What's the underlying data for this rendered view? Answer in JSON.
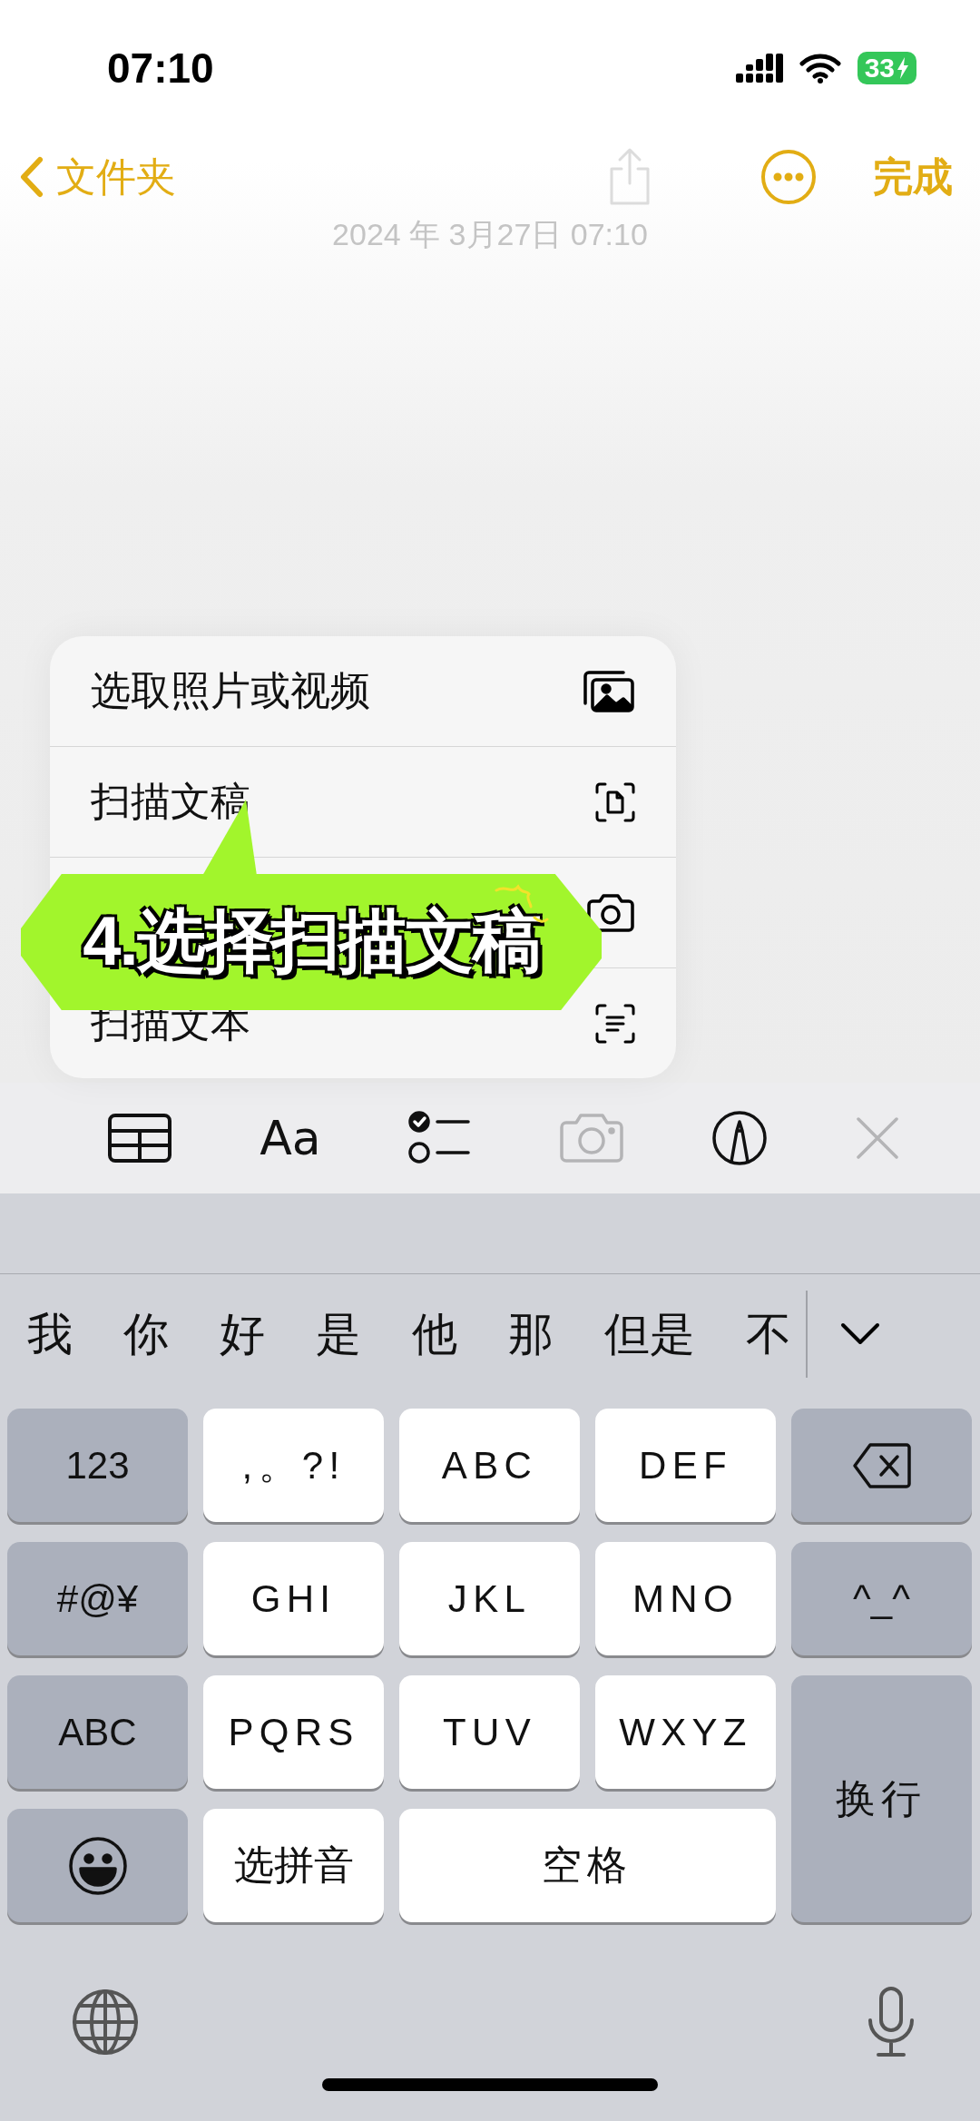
{
  "status_bar": {
    "time": "07:10",
    "battery": "33",
    "charging": true
  },
  "nav_bar": {
    "back_label": "文件夹",
    "done_label": "完成",
    "share_disabled": true
  },
  "note": {
    "date": "2024 年 3月27日 07:10"
  },
  "attach_menu": {
    "items": [
      {
        "kind": "photos",
        "label": "选取照片或视频"
      },
      {
        "kind": "scan-document",
        "label": "扫描文稿"
      },
      {
        "kind": "camera"
      },
      {
        "kind": "scan-text",
        "label": "扫描文本"
      }
    ]
  },
  "callout": {
    "text": "4.选择扫描文稿"
  },
  "format_toolbar": {
    "items": [
      {
        "kind": "table",
        "disabled": false
      },
      {
        "kind": "format",
        "label": "Aa",
        "disabled": false
      },
      {
        "kind": "checklist",
        "disabled": false
      },
      {
        "kind": "camera",
        "disabled": true
      },
      {
        "kind": "markup",
        "disabled": false
      },
      {
        "kind": "close",
        "disabled": true
      }
    ]
  },
  "candidates": {
    "words": [
      "我",
      "你",
      "好",
      "是",
      "他",
      "那",
      "但是",
      "不"
    ]
  },
  "keyboard": {
    "keys": [
      {
        "kind": "function",
        "label": "123"
      },
      {
        "kind": "letter",
        "label": ",。?!"
      },
      {
        "kind": "letter",
        "label": "ABC"
      },
      {
        "kind": "letter",
        "label": "DEF"
      },
      {
        "kind": "delete"
      },
      {
        "kind": "function",
        "label": "#@¥"
      },
      {
        "kind": "letter",
        "label": "GHI"
      },
      {
        "kind": "letter",
        "label": "JKL"
      },
      {
        "kind": "letter",
        "label": "MNO"
      },
      {
        "kind": "function",
        "label": "^_^"
      },
      {
        "kind": "function",
        "label": "ABC"
      },
      {
        "kind": "letter",
        "label": "PQRS"
      },
      {
        "kind": "letter",
        "label": "TUV"
      },
      {
        "kind": "letter",
        "label": "WXYZ"
      },
      {
        "kind": "return",
        "label": "换行"
      },
      {
        "kind": "emoji"
      },
      {
        "kind": "letter",
        "label": "选拼音"
      },
      {
        "kind": "space",
        "label": "空格"
      }
    ]
  }
}
